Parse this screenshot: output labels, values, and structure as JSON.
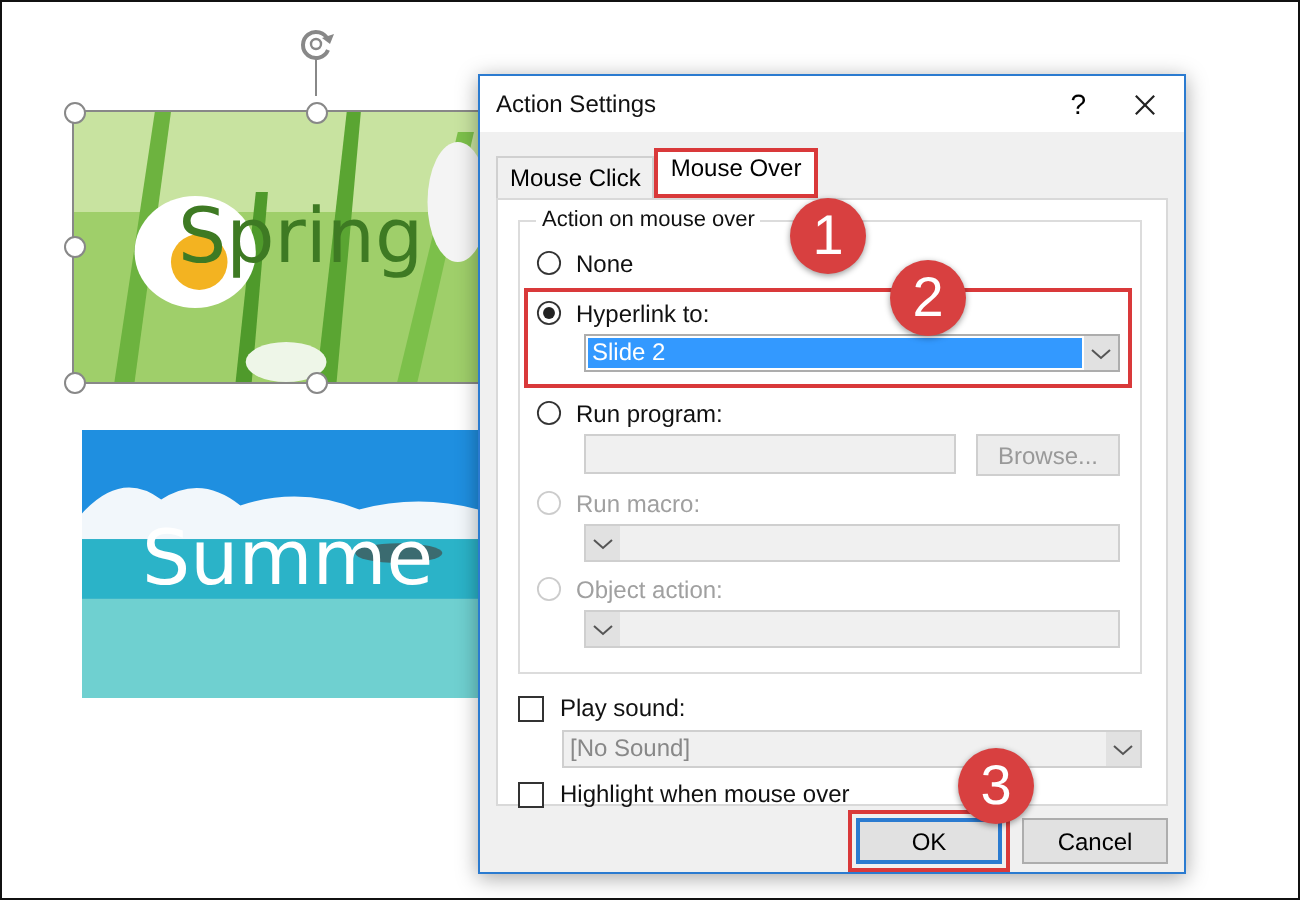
{
  "slide": {
    "images": [
      {
        "kind": "flowers",
        "caption": "Spring",
        "selected": true
      },
      {
        "kind": "beach",
        "caption": "Summe",
        "selected": false
      }
    ]
  },
  "dialog": {
    "title": "Action Settings",
    "help": "?",
    "tabs": [
      {
        "label": "Mouse Click",
        "selected": false,
        "highlighted": false
      },
      {
        "label": "Mouse Over",
        "selected": true,
        "highlighted": true
      }
    ],
    "group": {
      "title": "Action on mouse over",
      "options": [
        {
          "label": "None",
          "selected": false,
          "disabled": false
        },
        {
          "label": "Hyperlink to:",
          "selected": true,
          "disabled": false,
          "highlighted": true,
          "field": {
            "kind": "dropdown",
            "value": "Slide 2"
          }
        },
        {
          "label": "Run program:",
          "selected": false,
          "disabled": false,
          "field": {
            "kind": "text",
            "button": "Browse..."
          }
        },
        {
          "label": "Run macro:",
          "selected": false,
          "disabled": true,
          "field": {
            "kind": "dropdown"
          }
        },
        {
          "label": "Object action:",
          "selected": false,
          "disabled": true,
          "field": {
            "kind": "dropdown"
          }
        }
      ]
    },
    "play_sound": {
      "label": "Play sound:",
      "checked": false,
      "value": "[No Sound]"
    },
    "highlight": {
      "label": "Highlight when mouse over",
      "checked": false
    },
    "buttons": [
      {
        "label": "OK",
        "default": true,
        "highlighted": true
      },
      {
        "label": "Cancel",
        "default": false,
        "highlighted": false
      }
    ]
  },
  "callouts": [
    {
      "number": "1"
    },
    {
      "number": "2"
    },
    {
      "number": "3"
    }
  ]
}
